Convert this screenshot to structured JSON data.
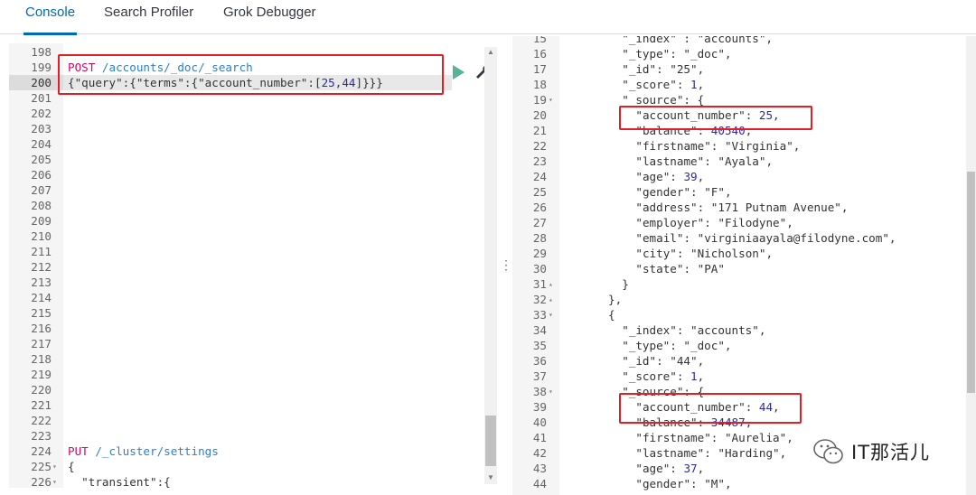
{
  "tabs": [
    {
      "label": "Console",
      "active": true
    },
    {
      "label": "Search Profiler",
      "active": false
    },
    {
      "label": "Grok Debugger",
      "active": false
    }
  ],
  "request_editor": {
    "lines": [
      {
        "n": "198",
        "fold": "",
        "parts": []
      },
      {
        "n": "199",
        "fold": "",
        "parts": [
          {
            "t": "POST ",
            "c": "k-method"
          },
          {
            "t": "/accounts/_doc/_search",
            "c": "k-url"
          }
        ]
      },
      {
        "n": "200",
        "fold": "",
        "hl": true,
        "parts": [
          {
            "t": "{\"query\":{\"terms",
            "c": "k-key"
          },
          {
            "t": "\":{\"account_number\":[",
            "c": "k-key"
          },
          {
            "t": "25",
            "c": "k-num"
          },
          {
            "t": ",",
            "c": "k-punc"
          },
          {
            "t": "44",
            "c": "k-num"
          },
          {
            "t": "]}}}",
            "c": "k-punc"
          }
        ]
      },
      {
        "n": "201",
        "fold": "",
        "parts": []
      },
      {
        "n": "202",
        "fold": "",
        "parts": []
      },
      {
        "n": "203",
        "fold": "",
        "parts": []
      },
      {
        "n": "204",
        "fold": "",
        "parts": []
      },
      {
        "n": "205",
        "fold": "",
        "parts": []
      },
      {
        "n": "206",
        "fold": "",
        "parts": []
      },
      {
        "n": "207",
        "fold": "",
        "parts": []
      },
      {
        "n": "208",
        "fold": "",
        "parts": []
      },
      {
        "n": "209",
        "fold": "",
        "parts": []
      },
      {
        "n": "210",
        "fold": "",
        "parts": []
      },
      {
        "n": "211",
        "fold": "",
        "parts": []
      },
      {
        "n": "212",
        "fold": "",
        "parts": []
      },
      {
        "n": "213",
        "fold": "",
        "parts": []
      },
      {
        "n": "214",
        "fold": "",
        "parts": []
      },
      {
        "n": "215",
        "fold": "",
        "parts": []
      },
      {
        "n": "216",
        "fold": "",
        "parts": []
      },
      {
        "n": "217",
        "fold": "",
        "parts": []
      },
      {
        "n": "218",
        "fold": "",
        "parts": []
      },
      {
        "n": "219",
        "fold": "",
        "parts": []
      },
      {
        "n": "220",
        "fold": "",
        "parts": []
      },
      {
        "n": "221",
        "fold": "",
        "parts": []
      },
      {
        "n": "222",
        "fold": "",
        "parts": []
      },
      {
        "n": "223",
        "fold": "",
        "parts": []
      },
      {
        "n": "224",
        "fold": "",
        "parts": [
          {
            "t": "PUT ",
            "c": "k-method"
          },
          {
            "t": "/_cluster/settings",
            "c": "k-url"
          }
        ]
      },
      {
        "n": "225",
        "fold": "▾",
        "parts": [
          {
            "t": "{",
            "c": "k-punc"
          }
        ]
      },
      {
        "n": "226",
        "fold": "▾",
        "parts": [
          {
            "t": "  \"transient\":{",
            "c": "k-key"
          }
        ]
      }
    ]
  },
  "response_viewer": {
    "lines": [
      {
        "n": "15",
        "fold": "",
        "indent": 6,
        "parts": [
          {
            "t": "\"_index\" : \"accounts\",",
            "c": "k-key"
          }
        ]
      },
      {
        "n": "16",
        "fold": "",
        "indent": 6,
        "parts": [
          {
            "t": "\"_type\": \"_doc\",",
            "c": "k-key"
          }
        ]
      },
      {
        "n": "17",
        "fold": "",
        "indent": 6,
        "parts": [
          {
            "t": "\"_id\": \"25\",",
            "c": "k-key"
          }
        ]
      },
      {
        "n": "18",
        "fold": "",
        "indent": 6,
        "parts": [
          {
            "t": "\"_score\": ",
            "c": "k-key"
          },
          {
            "t": "1",
            "c": "k-num"
          },
          {
            "t": ",",
            "c": "k-punc"
          }
        ]
      },
      {
        "n": "19",
        "fold": "▾",
        "indent": 6,
        "parts": [
          {
            "t": "\"_source\": {",
            "c": "k-key"
          }
        ]
      },
      {
        "n": "20",
        "fold": "",
        "indent": 8,
        "parts": [
          {
            "t": "\"account_number\": ",
            "c": "k-key"
          },
          {
            "t": "25",
            "c": "k-num"
          },
          {
            "t": ",",
            "c": "k-punc"
          }
        ]
      },
      {
        "n": "21",
        "fold": "",
        "indent": 8,
        "parts": [
          {
            "t": "\"balance\": ",
            "c": "k-key"
          },
          {
            "t": "40540",
            "c": "k-num"
          },
          {
            "t": ",",
            "c": "k-punc"
          }
        ]
      },
      {
        "n": "22",
        "fold": "",
        "indent": 8,
        "parts": [
          {
            "t": "\"firstname\": \"Virginia\",",
            "c": "k-key"
          }
        ]
      },
      {
        "n": "23",
        "fold": "",
        "indent": 8,
        "parts": [
          {
            "t": "\"lastname\": \"Ayala\",",
            "c": "k-key"
          }
        ]
      },
      {
        "n": "24",
        "fold": "",
        "indent": 8,
        "parts": [
          {
            "t": "\"age\": ",
            "c": "k-key"
          },
          {
            "t": "39",
            "c": "k-num"
          },
          {
            "t": ",",
            "c": "k-punc"
          }
        ]
      },
      {
        "n": "25",
        "fold": "",
        "indent": 8,
        "parts": [
          {
            "t": "\"gender\": \"F\",",
            "c": "k-key"
          }
        ]
      },
      {
        "n": "26",
        "fold": "",
        "indent": 8,
        "parts": [
          {
            "t": "\"address\": \"171 Putnam Avenue\",",
            "c": "k-key"
          }
        ]
      },
      {
        "n": "27",
        "fold": "",
        "indent": 8,
        "parts": [
          {
            "t": "\"employer\": \"Filodyne\",",
            "c": "k-key"
          }
        ]
      },
      {
        "n": "28",
        "fold": "",
        "indent": 8,
        "parts": [
          {
            "t": "\"email\": \"virginiaayala@filodyne.com\",",
            "c": "k-key"
          }
        ]
      },
      {
        "n": "29",
        "fold": "",
        "indent": 8,
        "parts": [
          {
            "t": "\"city\": \"Nicholson\",",
            "c": "k-key"
          }
        ]
      },
      {
        "n": "30",
        "fold": "",
        "indent": 8,
        "parts": [
          {
            "t": "\"state\": \"PA\"",
            "c": "k-key"
          }
        ]
      },
      {
        "n": "31",
        "fold": "▴",
        "indent": 6,
        "parts": [
          {
            "t": "}",
            "c": "k-punc"
          }
        ]
      },
      {
        "n": "32",
        "fold": "▴",
        "indent": 4,
        "parts": [
          {
            "t": "},",
            "c": "k-punc"
          }
        ]
      },
      {
        "n": "33",
        "fold": "▾",
        "indent": 4,
        "parts": [
          {
            "t": "{",
            "c": "k-punc"
          }
        ]
      },
      {
        "n": "34",
        "fold": "",
        "indent": 6,
        "parts": [
          {
            "t": "\"_index\": \"accounts\",",
            "c": "k-key"
          }
        ]
      },
      {
        "n": "35",
        "fold": "",
        "indent": 6,
        "parts": [
          {
            "t": "\"_type\": \"_doc\",",
            "c": "k-key"
          }
        ]
      },
      {
        "n": "36",
        "fold": "",
        "indent": 6,
        "parts": [
          {
            "t": "\"_id\": \"44\",",
            "c": "k-key"
          }
        ]
      },
      {
        "n": "37",
        "fold": "",
        "indent": 6,
        "parts": [
          {
            "t": "\"_score\": ",
            "c": "k-key"
          },
          {
            "t": "1",
            "c": "k-num"
          },
          {
            "t": ",",
            "c": "k-punc"
          }
        ]
      },
      {
        "n": "38",
        "fold": "▾",
        "indent": 6,
        "parts": [
          {
            "t": "\"_source\": {",
            "c": "k-key"
          }
        ]
      },
      {
        "n": "39",
        "fold": "",
        "indent": 8,
        "parts": [
          {
            "t": "\"account_number\": ",
            "c": "k-key"
          },
          {
            "t": "44",
            "c": "k-num"
          },
          {
            "t": ",",
            "c": "k-punc"
          }
        ]
      },
      {
        "n": "40",
        "fold": "",
        "indent": 8,
        "parts": [
          {
            "t": "\"balance\": ",
            "c": "k-key"
          },
          {
            "t": "34487",
            "c": "k-num"
          },
          {
            "t": ",",
            "c": "k-punc"
          }
        ]
      },
      {
        "n": "41",
        "fold": "",
        "indent": 8,
        "parts": [
          {
            "t": "\"firstname\": \"Aurelia\",",
            "c": "k-key"
          }
        ]
      },
      {
        "n": "42",
        "fold": "",
        "indent": 8,
        "parts": [
          {
            "t": "\"lastname\": \"Harding\",",
            "c": "k-key"
          }
        ]
      },
      {
        "n": "43",
        "fold": "",
        "indent": 8,
        "parts": [
          {
            "t": "\"age\": ",
            "c": "k-key"
          },
          {
            "t": "37",
            "c": "k-num"
          },
          {
            "t": ",",
            "c": "k-punc"
          }
        ]
      },
      {
        "n": "44",
        "fold": "",
        "indent": 8,
        "parts": [
          {
            "t": "\"gender\": \"M\",",
            "c": "k-key"
          }
        ]
      }
    ]
  },
  "toolbar": {
    "run_icon": "play-icon",
    "settings_icon": "wrench-icon"
  },
  "watermark": {
    "text": "IT那活儿",
    "icon": "wechat-icon"
  },
  "colors": {
    "accent": "#006bb4",
    "method": "#c80a68",
    "url": "#2d7fd0",
    "number": "#2a2aa3",
    "run": "#54b399",
    "highlight_box": "#e51d25"
  }
}
